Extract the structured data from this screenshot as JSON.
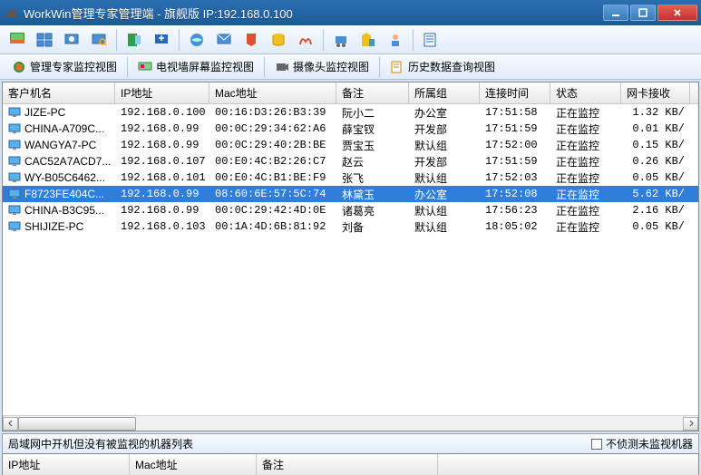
{
  "titlebar": {
    "text": "WorkWin管理专家管理端 - 旗舰版 IP:192.168.0.100"
  },
  "viewtabs": {
    "monitor": "管理专家监控视图",
    "tvwall": "电视墙屏幕监控视图",
    "camera": "摄像头监控视图",
    "history": "历史数据查询视图"
  },
  "columns": {
    "c0": "客户机名",
    "c1": "IP地址",
    "c2": "Mac地址",
    "c3": "备注",
    "c4": "所属组",
    "c5": "连接时间",
    "c6": "状态",
    "c7": "网卡接收"
  },
  "rows": [
    {
      "name": "JIZE-PC",
      "ip": "192.168.0.100",
      "mac": "00:16:D3:26:B3:39",
      "remark": "阮小二",
      "group": "办公室",
      "time": "17:51:58",
      "status": "正在监控",
      "rx": "1.32 KB/",
      "sel": false
    },
    {
      "name": "CHINA-A709C...",
      "ip": "192.168.0.99",
      "mac": "00:0C:29:34:62:A6",
      "remark": "薛宝钗",
      "group": "开发部",
      "time": "17:51:59",
      "status": "正在监控",
      "rx": "0.01 KB/",
      "sel": false
    },
    {
      "name": "WANGYA7-PC",
      "ip": "192.168.0.99",
      "mac": "00:0C:29:40:2B:BE",
      "remark": "贾宝玉",
      "group": "默认组",
      "time": "17:52:00",
      "status": "正在监控",
      "rx": "0.15 KB/",
      "sel": false
    },
    {
      "name": "CAC52A7ACD7...",
      "ip": "192.168.0.107",
      "mac": "00:E0:4C:B2:26:C7",
      "remark": "赵云",
      "group": "开发部",
      "time": "17:51:59",
      "status": "正在监控",
      "rx": "0.26 KB/",
      "sel": false
    },
    {
      "name": "WY-B05C6462...",
      "ip": "192.168.0.101",
      "mac": "00:E0:4C:B1:BE:F9",
      "remark": "张飞",
      "group": "默认组",
      "time": "17:52:03",
      "status": "正在监控",
      "rx": "0.05 KB/",
      "sel": false
    },
    {
      "name": "F8723FE404C...",
      "ip": "192.168.0.99",
      "mac": "08:60:6E:57:5C:74",
      "remark": "林黛玉",
      "group": "办公室",
      "time": "17:52:08",
      "status": "正在监控",
      "rx": "5.62 KB/",
      "sel": true
    },
    {
      "name": "CHINA-B3C95...",
      "ip": "192.168.0.99",
      "mac": "00:0C:29:42:4D:0E",
      "remark": "诸葛亮",
      "group": "默认组",
      "time": "17:56:23",
      "status": "正在监控",
      "rx": "2.16 KB/",
      "sel": false
    },
    {
      "name": "SHIJIZE-PC",
      "ip": "192.168.0.103",
      "mac": "00:1A:4D:6B:81:92",
      "remark": "刘备",
      "group": "默认组",
      "time": "18:05:02",
      "status": "正在监控",
      "rx": "0.05 KB/",
      "sel": false
    }
  ],
  "bottom": {
    "title": "局域网中开机但没有被监视的机器列表",
    "checkbox": "不侦测未监视机器",
    "cols": {
      "ip": "IP地址",
      "mac": "Mac地址",
      "remark": "备注"
    }
  }
}
